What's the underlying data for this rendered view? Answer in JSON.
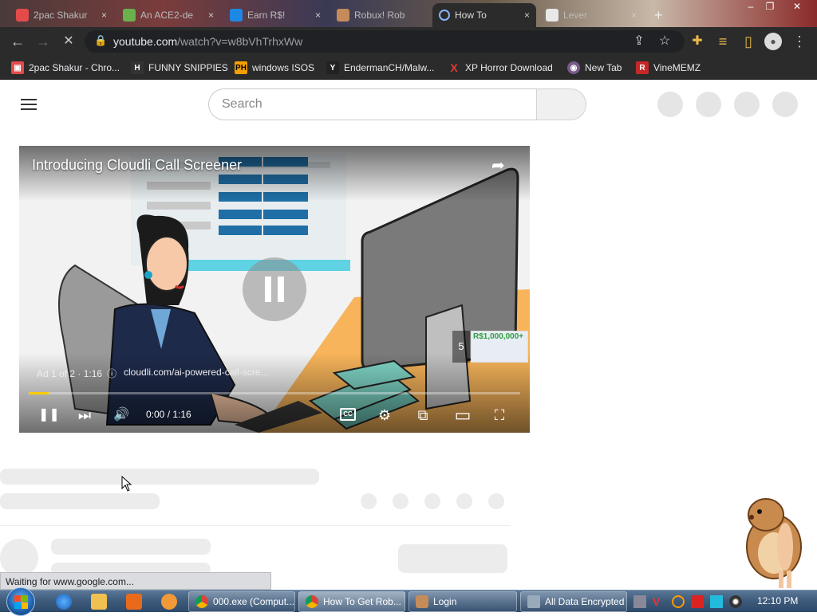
{
  "tabs": [
    {
      "title": "2pac Shakur",
      "close": "×",
      "color": "#e34b4b"
    },
    {
      "title": "An ACE2-de",
      "close": "×",
      "color": "#6ab04c"
    },
    {
      "title": "Earn R$!",
      "close": "×",
      "color": "#1e88e5"
    },
    {
      "title": "Robux! Rob",
      "close": "×",
      "color": "#c58b5a"
    },
    {
      "title": "How To",
      "close": "×",
      "color": "#2b2b2b"
    },
    {
      "title": "Lever",
      "close": "×",
      "color": "#e8e8e8"
    }
  ],
  "new_tab": "+",
  "window_controls": {
    "minimize": "–",
    "restore": "❐",
    "close": "✕"
  },
  "toolbar": {
    "back_icon": "←",
    "forward_icon": "→",
    "reload_icon": "✕",
    "url_host": "youtube.com",
    "url_path": "/watch?v=w8bVhTrhxWw",
    "lock_icon": "🔒",
    "share_icon": "⇪",
    "star_icon": "☆",
    "extension_icon": "✚",
    "media_icon": "≡",
    "sidepanel_icon": "▯",
    "profile_icon": "●",
    "menu_icon": "⋮"
  },
  "bookmarks": [
    {
      "label": "2pac Shakur - Chro...",
      "icon": "▣",
      "color": "#e34b4b"
    },
    {
      "label": "FUNNY SNIPPIES",
      "icon": "H",
      "color": "#333"
    },
    {
      "label": "windows ISOS",
      "icon": "PH",
      "color": "#f5a000"
    },
    {
      "label": "EndermanCH/Malw...",
      "icon": "Y",
      "color": "#222"
    },
    {
      "label": "XP Horror Download",
      "icon": "X",
      "color": "#d32f2f"
    },
    {
      "label": "New Tab",
      "icon": "◉",
      "color": "#7a5a8a"
    },
    {
      "label": "VineMEMZ",
      "icon": "R",
      "color": "#c62828"
    }
  ],
  "search": {
    "placeholder": "Search"
  },
  "video": {
    "title": "Introducing Cloudli Call Screener",
    "share_icon": "➦",
    "ad_label": "Ad 1 of 2 · 1:16",
    "info_icon": "ⓘ",
    "ad_url": "cloudli.com/ai-powered-call-scre...",
    "ad_skip_count": "5",
    "ad_thumb_text": "R$1,000,000+",
    "time": "0:00 / 1:16",
    "progress": 0.04,
    "controls": {
      "pause": "❚❚",
      "next": "⏭",
      "volume": "🔊",
      "cc": "CC",
      "settings": "⚙",
      "miniplayer": "⧉",
      "theater": "▭",
      "fullscreen": "⛶"
    }
  },
  "status_bar": "Waiting for www.google.com...",
  "taskbar": {
    "tasks": [
      {
        "label": "000.exe (Comput...",
        "icon_color": "#f4b400"
      },
      {
        "label": "How To Get Rob...",
        "icon_color": "#f4b400"
      },
      {
        "label": "Login",
        "icon_color": "#c58b5a"
      },
      {
        "label": "All Data Encrypted",
        "icon_color": "#9ab"
      }
    ],
    "clock": "12:10 PM"
  }
}
